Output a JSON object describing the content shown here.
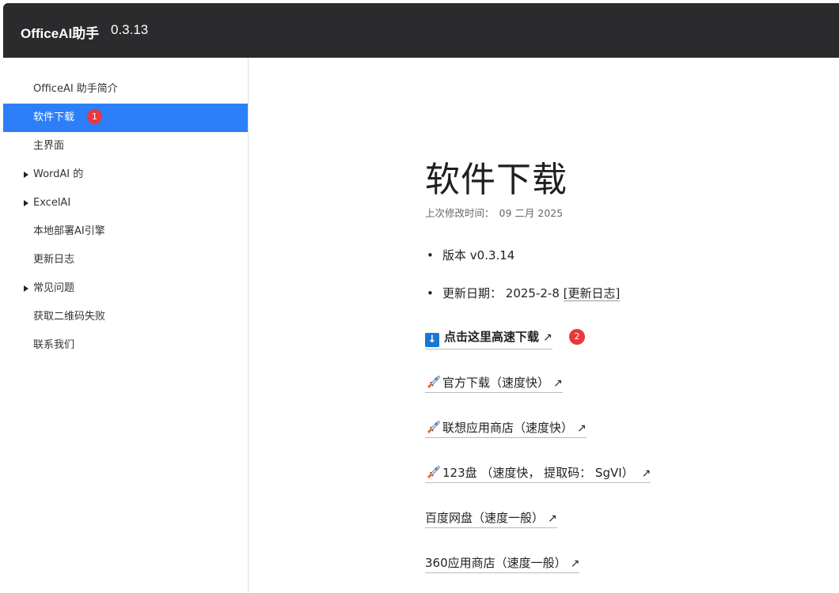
{
  "header": {
    "brand": "OfficeAI助手",
    "version": "0.3.13"
  },
  "sidebar": {
    "items": [
      {
        "label": "OfficeAI 助手简介",
        "expandable": false,
        "active": false
      },
      {
        "label": "软件下载",
        "expandable": false,
        "active": true,
        "badge": "1"
      },
      {
        "label": "主界面",
        "expandable": false,
        "active": false
      },
      {
        "label": "WordAI 的",
        "expandable": true,
        "active": false
      },
      {
        "label": "ExcelAI",
        "expandable": true,
        "active": false
      },
      {
        "label": "本地部署AI引擎",
        "expandable": false,
        "active": false
      },
      {
        "label": "更新日志",
        "expandable": false,
        "active": false
      },
      {
        "label": "常见问题",
        "expandable": true,
        "active": false
      },
      {
        "label": "获取二维码失败",
        "expandable": false,
        "active": false
      },
      {
        "label": "联系我们",
        "expandable": false,
        "active": false
      }
    ]
  },
  "main": {
    "title": "软件下载",
    "modified_label": "上次修改时间：",
    "modified_date": "09 二月 2025",
    "bullets": {
      "version": "版本 v0.3.14",
      "update_label": "更新日期：",
      "update_date": "2025-2-8",
      "changelog_link": "[更新日志]"
    },
    "downloads": {
      "primary": {
        "icon": "download-icon",
        "label": "点击这里高速下载",
        "arrow": "↗",
        "badge": "2"
      },
      "official": {
        "icon": "rocket-icon",
        "label": "官方下载（速度快）",
        "arrow": "↗"
      },
      "lenovo": {
        "icon": "rocket-icon",
        "label": "联想应用商店（速度快）",
        "arrow": "↗"
      },
      "pan123": {
        "icon": "rocket-icon",
        "label": "123盘 （速度快， 提取码： SgVI） ",
        "arrow": "↗"
      },
      "baidu": {
        "label": "百度网盘（速度一般）",
        "arrow": "↗"
      },
      "store360": {
        "label": "360应用商店（速度一般）",
        "arrow": "↗"
      }
    }
  },
  "colors": {
    "topbar": "#2b2b2d",
    "active_nav": "#2d7ff9",
    "badge": "#e8383d",
    "download_box": "#1976d2"
  }
}
